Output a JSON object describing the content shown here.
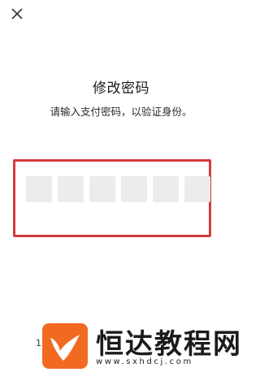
{
  "dialog": {
    "title": "修改密码",
    "subtitle": "请输入支付密码，以验证身份。"
  },
  "password": {
    "length": 6,
    "digit_fill_color": "#ececec",
    "highlight_color": "#d43a3a"
  },
  "bottom_fragment": "1",
  "watermark": {
    "name": "恒达教程网",
    "url": "www.sxhdcj.com",
    "logo_color": "#f26a21"
  }
}
